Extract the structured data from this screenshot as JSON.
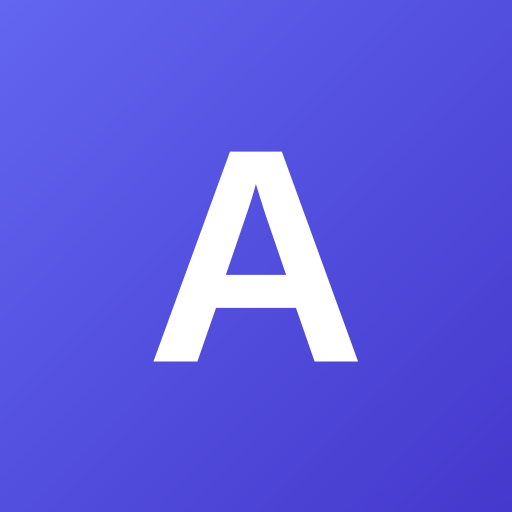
{
  "tile": {
    "letter": "A",
    "background_start": "#6266f0",
    "background_end": "#4538cc",
    "foreground": "#ffffff"
  }
}
